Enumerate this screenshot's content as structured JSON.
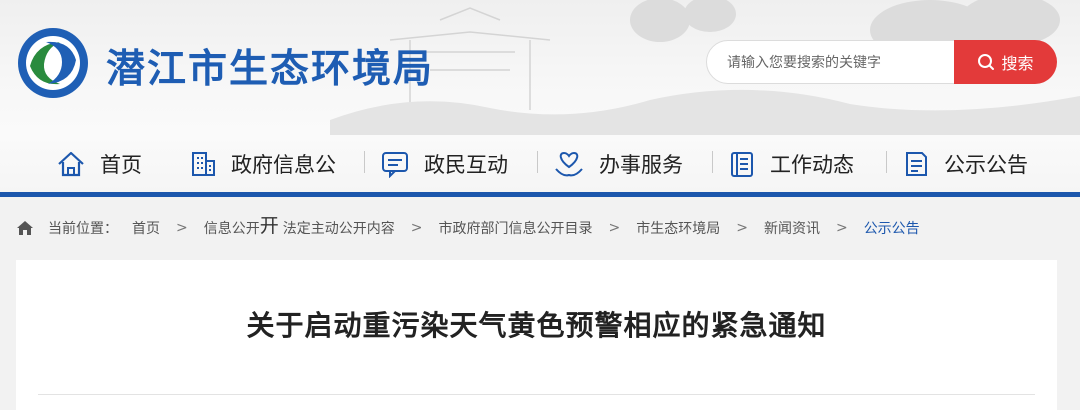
{
  "header": {
    "site_title": "潜江市生态环境局",
    "search": {
      "placeholder": "请输入您要搜索的关键字",
      "button_label": "搜索"
    }
  },
  "nav": {
    "items": [
      {
        "label": "首页",
        "icon": "home-icon"
      },
      {
        "label": "政府信息公",
        "icon": "building-icon"
      },
      {
        "label": "政民互动",
        "icon": "chat-icon"
      },
      {
        "label": "办事服务",
        "icon": "heart-hand-icon"
      },
      {
        "label": "工作动态",
        "icon": "document-icon"
      },
      {
        "label": "公示公告",
        "icon": "notice-icon"
      }
    ]
  },
  "breadcrumb": {
    "prefix": "当前位置：",
    "items": [
      "首页",
      "信息公开",
      "开",
      "法定主动公开内容",
      "市政府部门信息公开目录",
      "市生态环境局",
      "新闻资讯",
      "公示公告"
    ]
  },
  "article": {
    "title": "关于启动重污染天气黄色预警相应的紧急通知"
  },
  "colors": {
    "brand_blue": "#1c57ad",
    "search_red": "#e33a3a",
    "current_crumb": "#1c57ad"
  }
}
